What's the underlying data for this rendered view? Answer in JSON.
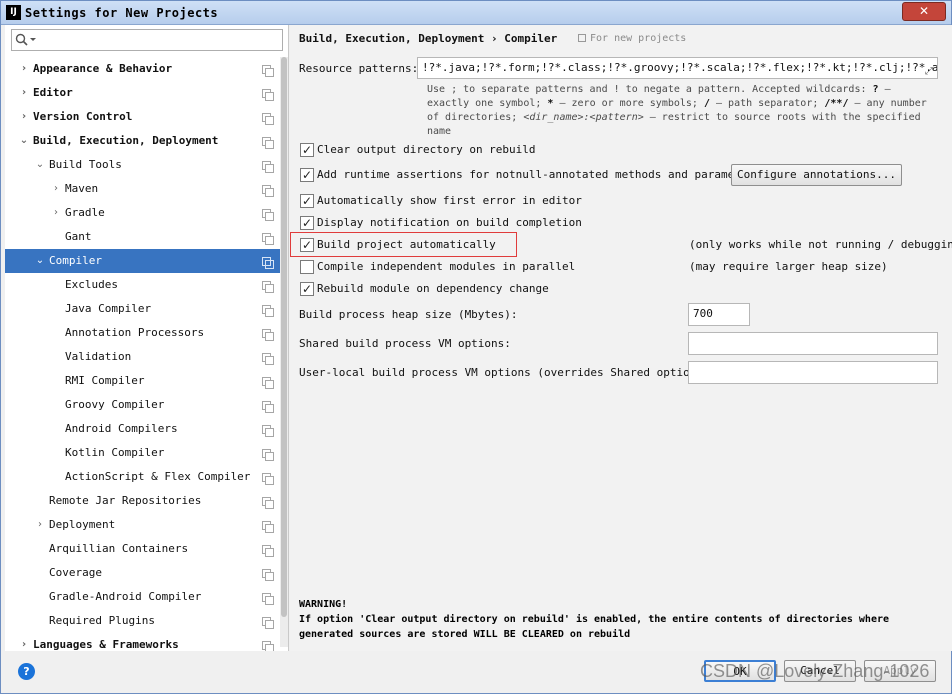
{
  "window": {
    "title": "Settings for New Projects",
    "app_icon_text": "IJ",
    "close_label": "✕"
  },
  "sidebar": {
    "search": {
      "placeholder": ""
    },
    "items": [
      {
        "label": "Appearance & Behavior",
        "level": 0,
        "arrow": "›",
        "bold": true
      },
      {
        "label": "Editor",
        "level": 0,
        "arrow": "›",
        "bold": true
      },
      {
        "label": "Version Control",
        "level": 0,
        "arrow": "›",
        "bold": true
      },
      {
        "label": "Build, Execution, Deployment",
        "level": 0,
        "arrow": "⌄",
        "bold": true
      },
      {
        "label": "Build Tools",
        "level": 1,
        "arrow": "⌄"
      },
      {
        "label": "Maven",
        "level": 2,
        "arrow": "›"
      },
      {
        "label": "Gradle",
        "level": 2,
        "arrow": "›"
      },
      {
        "label": "Gant",
        "level": 2,
        "arrow": ""
      },
      {
        "label": "Compiler",
        "level": 1,
        "arrow": "⌄",
        "selected": true
      },
      {
        "label": "Excludes",
        "level": 2,
        "arrow": ""
      },
      {
        "label": "Java Compiler",
        "level": 2,
        "arrow": ""
      },
      {
        "label": "Annotation Processors",
        "level": 2,
        "arrow": ""
      },
      {
        "label": "Validation",
        "level": 2,
        "arrow": ""
      },
      {
        "label": "RMI Compiler",
        "level": 2,
        "arrow": ""
      },
      {
        "label": "Groovy Compiler",
        "level": 2,
        "arrow": ""
      },
      {
        "label": "Android Compilers",
        "level": 2,
        "arrow": ""
      },
      {
        "label": "Kotlin Compiler",
        "level": 2,
        "arrow": ""
      },
      {
        "label": "ActionScript & Flex Compiler",
        "level": 2,
        "arrow": ""
      },
      {
        "label": "Remote Jar Repositories",
        "level": 1,
        "arrow": ""
      },
      {
        "label": "Deployment",
        "level": 1,
        "arrow": "›"
      },
      {
        "label": "Arquillian Containers",
        "level": 1,
        "arrow": ""
      },
      {
        "label": "Coverage",
        "level": 1,
        "arrow": ""
      },
      {
        "label": "Gradle-Android Compiler",
        "level": 1,
        "arrow": ""
      },
      {
        "label": "Required Plugins",
        "level": 1,
        "arrow": ""
      },
      {
        "label": "Languages & Frameworks",
        "level": 0,
        "arrow": "›",
        "bold": true
      }
    ]
  },
  "main": {
    "breadcrumb": "Build, Execution, Deployment  ›  Compiler",
    "for_new_projects": "For new projects",
    "resource_patterns": {
      "label": "Resource patterns:",
      "value": "!?*.java;!?*.form;!?*.class;!?*.groovy;!?*.scala;!?*.flex;!?*.kt;!?*.clj;!?*.aj"
    },
    "hint": {
      "p1": "Use ; to separate patterns and ! to negate a pattern. Accepted wildcards: ",
      "w1": "?",
      "p2": " — exactly one symbol; ",
      "w2": "*",
      "p3": " — zero or more symbols; ",
      "w3": "/",
      "p4": " — path separator; ",
      "w4": "/**/",
      "p5": " — any number of directories; ",
      "w5": "<dir_name>:<pattern>",
      "p6": " — restrict to source roots with the specified name"
    },
    "options": {
      "clear_output": {
        "label": "Clear output directory on rebuild",
        "checked": true
      },
      "runtime_assertions": {
        "label": "Add runtime assertions for notnull-annotated methods and parameters",
        "checked": true
      },
      "configure_annotations": "Configure annotations...",
      "show_first_error": {
        "label": "Automatically show first error in editor",
        "checked": true
      },
      "display_notification": {
        "label": "Display notification on build completion",
        "checked": true
      },
      "build_automatically": {
        "label": "Build project automatically",
        "checked": true,
        "note": "(only works while not running / debugging)"
      },
      "compile_parallel": {
        "label": "Compile independent modules in parallel",
        "checked": false,
        "note": "(may require larger heap size)"
      },
      "rebuild_on_dependency": {
        "label": "Rebuild module on dependency change",
        "checked": true
      }
    },
    "heap": {
      "label": "Build process heap size (Mbytes):",
      "value": "700"
    },
    "shared_vm": {
      "label": "Shared build process VM options:",
      "value": ""
    },
    "user_vm": {
      "label": "User-local build process VM options (overrides Shared options):",
      "value": ""
    },
    "warning": {
      "title": "WARNING!",
      "line1": "If option 'Clear output directory on rebuild' is enabled, the entire contents of directories where",
      "line2": "generated sources are stored WILL BE CLEARED on rebuild"
    }
  },
  "footer": {
    "help": "?",
    "ok": "OK",
    "cancel": "Cancel",
    "apply": "Apply",
    "watermark": "CSDN @Lovely-Zhang-1026"
  },
  "colors": {
    "selection": "#3874c1",
    "highlight_box": "#e03c3c",
    "help_icon": "#1a73d9"
  }
}
